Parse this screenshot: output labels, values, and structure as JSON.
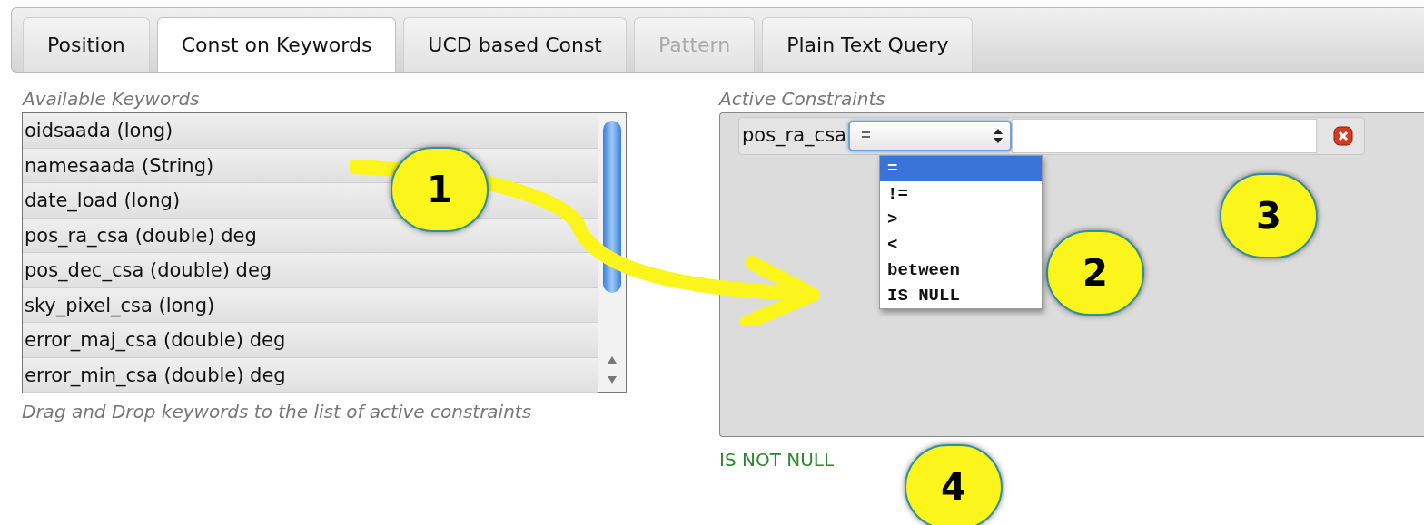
{
  "tabs": [
    {
      "label": "Position",
      "selected": false,
      "disabled": false
    },
    {
      "label": "Const on Keywords",
      "selected": true,
      "disabled": false
    },
    {
      "label": "UCD based Const",
      "selected": false,
      "disabled": false
    },
    {
      "label": "Pattern",
      "selected": false,
      "disabled": true
    },
    {
      "label": "Plain Text Query",
      "selected": false,
      "disabled": false
    }
  ],
  "available_keywords": {
    "title": "Available Keywords",
    "items": [
      "oidsaada (long)",
      "namesaada (String)",
      "date_load (long)",
      "pos_ra_csa (double) deg",
      "pos_dec_csa (double) deg",
      "sky_pixel_csa (long)",
      "error_maj_csa (double) deg",
      "error_min_csa (double) deg"
    ],
    "hint": "Drag and Drop keywords to the list of active constraints"
  },
  "active_constraints": {
    "title": "Active Constraints",
    "constraints": [
      {
        "keyword": "pos_ra_csa",
        "operator": "=",
        "expanded": true,
        "options": [
          {
            "label": "=",
            "selected": true
          },
          {
            "label": "!=",
            "selected": false
          },
          {
            "label": ">",
            "selected": false
          },
          {
            "label": "<",
            "selected": false
          },
          {
            "label": "between",
            "selected": false
          },
          {
            "label": "IS NULL",
            "selected": false
          }
        ]
      }
    ]
  },
  "status": "IS NOT NULL",
  "callouts": [
    "1",
    "2",
    "3",
    "4"
  ]
}
